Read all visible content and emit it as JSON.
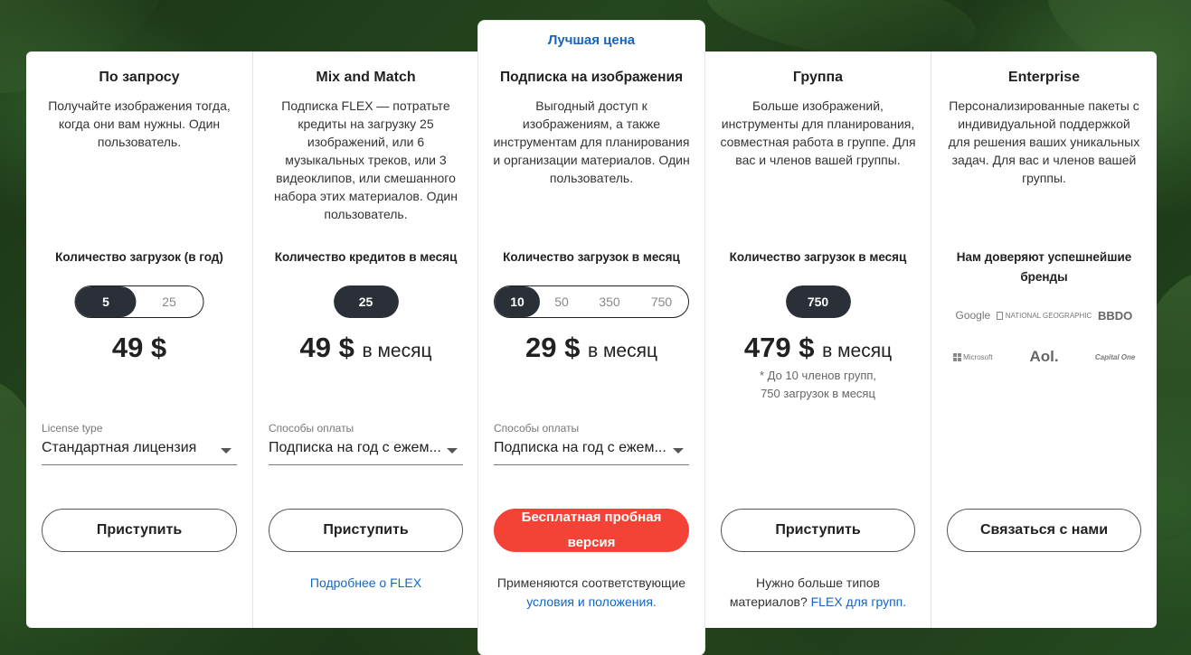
{
  "plans": [
    {
      "title": "По запросу",
      "description": "Получайте изображения тогда, когда они вам нужны. Один пользователь.",
      "qty_label": "Количество загрузок (в год)",
      "options": [
        "5",
        "25"
      ],
      "selected_index": 0,
      "price": "49 $",
      "per": "",
      "field_label": "License type",
      "field_value": "Стандартная лицензия",
      "button": "Приступить"
    },
    {
      "title": "Mix and Match",
      "description": "Подписка FLEX — потратьте кредиты на загрузку 25 изображений, или 6 музыкальных треков, или 3 видеоклипов, или смешанного набора этих материалов. Один пользователь.",
      "qty_label": "Количество кредитов в месяц",
      "options": [
        "25"
      ],
      "selected_index": 0,
      "price": "49 $",
      "per": "в месяц",
      "field_label": "Способы оплаты",
      "field_value": "Подписка на год с ежем...",
      "button": "Приступить",
      "footer_link": "Подробнее о FLEX"
    },
    {
      "badge": "Лучшая цена",
      "title": "Подписка на изображения",
      "description": "Выгодный доступ к изображениям, а также инструментам для планирования и организации материалов. Один пользователь.",
      "qty_label": "Количество загрузок в месяц",
      "options": [
        "10",
        "50",
        "350",
        "750"
      ],
      "selected_index": 0,
      "price": "29 $",
      "per": "в месяц",
      "field_label": "Способы оплаты",
      "field_value": "Подписка на год с ежем...",
      "button_line1": "Бесплатная пробная",
      "button_line2": "версия",
      "footer_text": "Применяются соответствующие",
      "footer_link": "условия и положения."
    },
    {
      "title": "Группа",
      "description": "Больше изображений, инструменты для планирования, совместная работа в группе. Для вас и членов вашей группы.",
      "qty_label": "Количество загрузок в месяц",
      "options": [
        "750"
      ],
      "selected_index": 0,
      "price": "479 $",
      "per": "в месяц",
      "note_line1": "* До 10 членов групп,",
      "note_line2": "750 загрузок в месяц",
      "button": "Приступить",
      "footer_text": "Нужно больше типов материалов?",
      "footer_link": "FLEX для групп."
    },
    {
      "title": "Enterprise",
      "description": "Персонализированные пакеты с индивидуальной поддержкой для решения ваших уникальных задач. Для вас и членов вашей группы.",
      "qty_label": "Нам доверяют успешнейшие бренды",
      "brands": [
        "Google",
        "NATIONAL GEOGRAPHIC",
        "BBDO",
        "Microsoft",
        "Aol.",
        "Capital One"
      ],
      "button": "Связаться с нами"
    }
  ],
  "colors": {
    "accent_blue": "#1565c0",
    "trial_red": "#f44336",
    "selected_dark": "#2b3038"
  }
}
